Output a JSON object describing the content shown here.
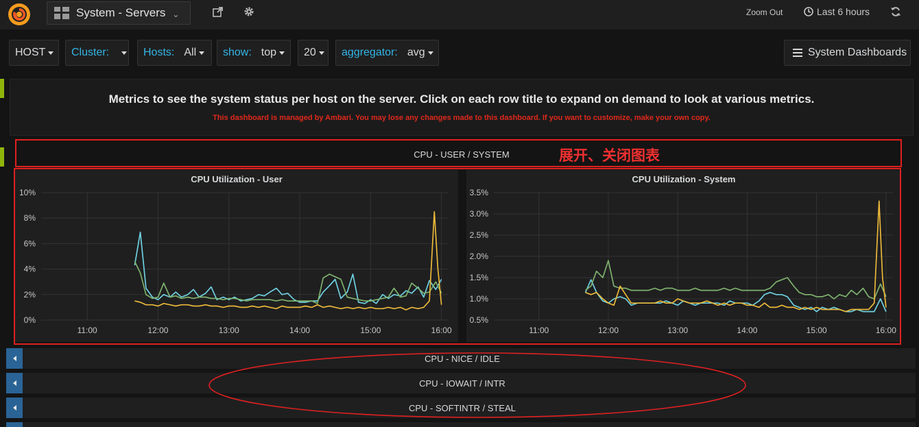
{
  "topnav": {
    "dashboard_title": "System - Servers",
    "zoom_out": "Zoom Out",
    "time_range": "Last 6 hours"
  },
  "variables": [
    {
      "label": "HOST",
      "value": ""
    },
    {
      "label": "Cluster:",
      "value": ""
    },
    {
      "label": "Hosts:",
      "value": "All"
    },
    {
      "label": "show:",
      "value": "top"
    },
    {
      "label": "20",
      "value": ""
    },
    {
      "label": "aggregator:",
      "value": "avg"
    }
  ],
  "system_dashboards": "System Dashboards",
  "text_panel": {
    "main": "Metrics to see the system status per host on the server. Click on each row title to expand on demand to look at various metrics.",
    "warning": "This dashboard is managed by Ambari. You may lose any changes made to this dashboard. If you want to customize, make your own copy."
  },
  "row": {
    "title": "CPU - USER / SYSTEM",
    "annotation": "展开、关闭图表"
  },
  "collapsed_rows": [
    "CPU - NICE / IDLE",
    "CPU - IOWAIT / INTR",
    "CPU - SOFTINTR / STEAL"
  ],
  "colors": {
    "series_cyan": "#6ed0e0",
    "series_green": "#7eb26d",
    "series_yellow": "#eab839",
    "annotation_red": "#e02020",
    "var_label": "#33b5e5"
  },
  "chart_data": [
    {
      "type": "line",
      "title": "CPU Utilization - User",
      "x_ticks": [
        "11:00",
        "12:00",
        "13:00",
        "14:00",
        "15:00",
        "16:00"
      ],
      "y_ticks": [
        "10%",
        "8%",
        "6%",
        "4%",
        "2%",
        "0%"
      ],
      "ylim": [
        0,
        10
      ],
      "xlim": [
        10.35,
        16.1
      ],
      "grid": true,
      "series": [
        {
          "color": "cyan",
          "x": [
            11.67,
            11.75,
            11.83,
            11.92,
            12.0,
            12.08,
            12.17,
            12.25,
            12.33,
            12.42,
            12.5,
            12.58,
            12.67,
            12.75,
            12.83,
            12.92,
            13.0,
            13.08,
            13.17,
            13.25,
            13.33,
            13.42,
            13.5,
            13.58,
            13.67,
            13.75,
            13.83,
            13.92,
            14.0,
            14.08,
            14.17,
            14.25,
            14.33,
            14.42,
            14.5,
            14.58,
            14.67,
            14.75,
            14.83,
            14.92,
            15.0,
            15.08,
            15.17,
            15.25,
            15.33,
            15.42,
            15.5,
            15.58,
            15.67,
            15.75,
            15.83,
            15.92,
            16.0
          ],
          "values": [
            4.3,
            6.9,
            2.5,
            1.8,
            1.6,
            2.0,
            1.8,
            2.2,
            1.8,
            2.0,
            2.4,
            1.8,
            2.1,
            2.6,
            1.6,
            1.8,
            1.6,
            1.8,
            1.5,
            1.6,
            1.7,
            2.0,
            1.9,
            2.2,
            2.5,
            2.0,
            2.1,
            1.6,
            1.4,
            1.4,
            1.5,
            1.5,
            2.2,
            2.7,
            3.2,
            1.7,
            2.2,
            3.6,
            1.4,
            1.3,
            1.6,
            1.3,
            2.0,
            1.7,
            2.0,
            1.9,
            2.3,
            2.1,
            2.6,
            1.8,
            3.1,
            2.4,
            3.2
          ]
        },
        {
          "color": "green",
          "x": [
            11.67,
            11.75,
            11.83,
            11.92,
            12.0,
            12.08,
            12.17,
            12.25,
            12.33,
            12.42,
            12.5,
            12.58,
            12.67,
            12.75,
            12.83,
            12.92,
            13.0,
            13.08,
            13.17,
            13.25,
            13.33,
            13.42,
            13.5,
            13.58,
            13.67,
            13.75,
            13.83,
            13.92,
            14.0,
            14.08,
            14.17,
            14.25,
            14.33,
            14.42,
            14.5,
            14.58,
            14.67,
            14.75,
            14.83,
            14.92,
            15.0,
            15.08,
            15.17,
            15.25,
            15.33,
            15.42,
            15.5,
            15.58,
            15.67,
            15.75,
            15.83,
            15.92,
            16.0
          ],
          "values": [
            4.6,
            3.7,
            2.0,
            1.7,
            1.8,
            2.9,
            1.8,
            1.9,
            1.7,
            1.8,
            1.7,
            1.8,
            1.8,
            1.7,
            1.7,
            1.6,
            1.7,
            1.7,
            1.6,
            1.5,
            1.6,
            1.6,
            1.6,
            1.6,
            1.5,
            1.6,
            1.5,
            1.5,
            1.5,
            1.5,
            1.5,
            1.3,
            3.3,
            3.6,
            3.4,
            3.2,
            1.8,
            1.7,
            1.6,
            1.5,
            1.5,
            1.6,
            1.7,
            1.8,
            2.5,
            1.8,
            1.9,
            2.9,
            2.5,
            2.1,
            2.2,
            3.0,
            2.1
          ]
        },
        {
          "color": "yellow",
          "x": [
            11.67,
            11.75,
            11.83,
            11.92,
            12.0,
            12.08,
            12.17,
            12.25,
            12.33,
            12.42,
            12.5,
            12.58,
            12.67,
            12.75,
            12.83,
            12.92,
            13.0,
            13.08,
            13.17,
            13.25,
            13.33,
            13.42,
            13.5,
            13.58,
            13.67,
            13.75,
            13.83,
            13.92,
            14.0,
            14.08,
            14.17,
            14.25,
            14.33,
            14.42,
            14.5,
            14.58,
            14.67,
            14.75,
            14.83,
            14.92,
            15.0,
            15.08,
            15.17,
            15.25,
            15.33,
            15.42,
            15.5,
            15.58,
            15.67,
            15.75,
            15.83,
            15.9,
            15.95,
            16.0
          ],
          "values": [
            1.5,
            1.4,
            1.2,
            1.2,
            1.1,
            1.3,
            1.2,
            1.1,
            1.2,
            1.2,
            1.1,
            1.1,
            1.2,
            1.1,
            1.1,
            1.0,
            1.1,
            1.1,
            1.0,
            1.0,
            1.1,
            1.0,
            1.1,
            1.0,
            0.9,
            1.1,
            1.0,
            1.0,
            1.0,
            1.1,
            1.0,
            1.2,
            1.0,
            1.1,
            1.0,
            0.9,
            1.0,
            0.9,
            1.0,
            0.9,
            1.0,
            0.9,
            0.9,
            1.0,
            0.9,
            1.0,
            0.8,
            1.0,
            0.9,
            1.0,
            1.5,
            8.5,
            4.0,
            1.2
          ]
        }
      ]
    },
    {
      "type": "line",
      "title": "CPU Utilization - System",
      "x_ticks": [
        "11:00",
        "12:00",
        "13:00",
        "14:00",
        "15:00",
        "16:00"
      ],
      "y_ticks": [
        "3.5%",
        "3.0%",
        "2.5%",
        "2.0%",
        "1.5%",
        "1.0%",
        "0.5%"
      ],
      "ylim": [
        0.5,
        3.5
      ],
      "xlim": [
        10.35,
        16.1
      ],
      "grid": true,
      "series": [
        {
          "color": "cyan",
          "x": [
            11.67,
            11.75,
            11.83,
            11.92,
            12.0,
            12.08,
            12.17,
            12.25,
            12.33,
            12.42,
            12.5,
            12.58,
            12.67,
            12.75,
            12.83,
            12.92,
            13.0,
            13.08,
            13.17,
            13.25,
            13.33,
            13.42,
            13.5,
            13.58,
            13.67,
            13.75,
            13.83,
            13.92,
            14.0,
            14.08,
            14.17,
            14.25,
            14.33,
            14.42,
            14.5,
            14.58,
            14.67,
            14.75,
            14.83,
            14.92,
            15.0,
            15.08,
            15.17,
            15.25,
            15.33,
            15.42,
            15.5,
            15.58,
            15.67,
            15.75,
            15.83,
            15.92,
            16.0
          ],
          "values": [
            1.15,
            1.45,
            1.15,
            0.95,
            0.9,
            1.0,
            1.05,
            1.0,
            0.85,
            0.9,
            0.9,
            0.9,
            0.9,
            0.9,
            0.95,
            0.9,
            0.85,
            0.95,
            0.9,
            0.85,
            0.9,
            0.9,
            0.9,
            0.9,
            0.85,
            0.95,
            0.9,
            0.9,
            0.9,
            0.85,
            0.95,
            1.1,
            1.15,
            1.1,
            1.1,
            1.05,
            0.85,
            0.8,
            0.75,
            0.8,
            0.7,
            0.8,
            0.75,
            0.8,
            0.75,
            0.7,
            0.7,
            0.75,
            0.7,
            0.7,
            0.7,
            1.0,
            0.7
          ]
        },
        {
          "color": "green",
          "x": [
            11.67,
            11.75,
            11.83,
            11.92,
            12.0,
            12.08,
            12.17,
            12.25,
            12.33,
            12.42,
            12.5,
            12.58,
            12.67,
            12.75,
            12.83,
            12.92,
            13.0,
            13.08,
            13.17,
            13.25,
            13.33,
            13.42,
            13.5,
            13.58,
            13.67,
            13.75,
            13.83,
            13.92,
            14.0,
            14.08,
            14.17,
            14.25,
            14.33,
            14.42,
            14.5,
            14.58,
            14.67,
            14.75,
            14.83,
            14.92,
            15.0,
            15.08,
            15.17,
            15.25,
            15.33,
            15.42,
            15.5,
            15.58,
            15.67,
            15.75,
            15.83,
            15.92,
            16.0
          ],
          "values": [
            1.2,
            1.3,
            1.65,
            1.5,
            1.9,
            1.3,
            1.25,
            1.25,
            1.2,
            1.2,
            1.2,
            1.2,
            1.25,
            1.2,
            1.25,
            1.25,
            1.2,
            1.2,
            1.2,
            1.25,
            1.2,
            1.2,
            1.2,
            1.2,
            1.25,
            1.2,
            1.25,
            1.2,
            1.2,
            1.2,
            1.2,
            1.2,
            1.25,
            1.4,
            1.45,
            1.5,
            1.3,
            1.15,
            1.1,
            1.1,
            1.05,
            1.05,
            1.1,
            1.0,
            1.1,
            1.05,
            1.2,
            1.1,
            1.25,
            1.05,
            1.0,
            1.35,
            1.05
          ]
        },
        {
          "color": "yellow",
          "x": [
            11.67,
            11.75,
            11.83,
            11.92,
            12.0,
            12.08,
            12.17,
            12.25,
            12.33,
            12.42,
            12.5,
            12.58,
            12.67,
            12.75,
            12.83,
            12.92,
            13.0,
            13.08,
            13.17,
            13.25,
            13.33,
            13.42,
            13.5,
            13.58,
            13.67,
            13.75,
            13.83,
            13.92,
            14.0,
            14.08,
            14.17,
            14.25,
            14.33,
            14.42,
            14.5,
            14.58,
            14.67,
            14.75,
            14.83,
            14.92,
            15.0,
            15.08,
            15.17,
            15.25,
            15.33,
            15.42,
            15.5,
            15.58,
            15.67,
            15.75,
            15.83,
            15.9,
            15.95,
            16.0
          ],
          "values": [
            1.15,
            1.1,
            1.15,
            1.0,
            0.9,
            0.85,
            1.3,
            1.1,
            0.9,
            0.9,
            0.9,
            0.9,
            0.9,
            0.95,
            0.9,
            0.9,
            1.0,
            0.95,
            0.9,
            0.9,
            0.9,
            0.95,
            0.9,
            0.85,
            0.9,
            0.85,
            0.9,
            0.9,
            0.85,
            0.85,
            0.8,
            0.9,
            0.8,
            0.8,
            0.85,
            0.8,
            0.8,
            0.75,
            0.8,
            0.75,
            0.8,
            0.75,
            0.75,
            0.75,
            0.75,
            0.7,
            0.75,
            0.75,
            0.75,
            0.75,
            0.9,
            3.3,
            1.5,
            0.8
          ]
        }
      ]
    }
  ]
}
